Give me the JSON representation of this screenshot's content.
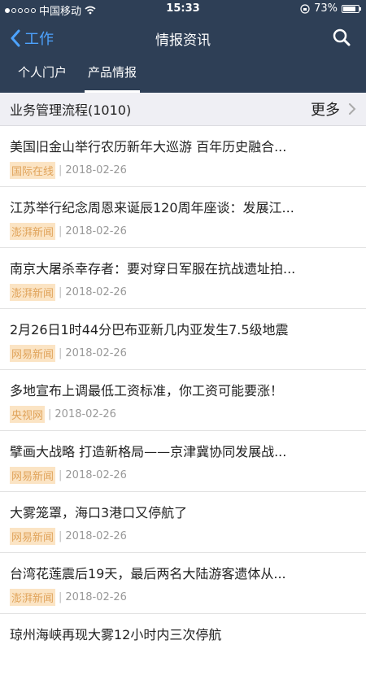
{
  "status_bar": {
    "carrier": "中国移动",
    "time": "15:33",
    "battery": "73%",
    "battery_level": 0.73
  },
  "nav": {
    "back_label": "工作",
    "title": "情报资讯"
  },
  "tabs": [
    {
      "label": "个人门户",
      "active": false
    },
    {
      "label": "产品情报",
      "active": true
    }
  ],
  "section": {
    "title": "业务管理流程(1010)",
    "more_label": "更多"
  },
  "news": [
    {
      "title": "美国旧金山举行农历新年大巡游 百年历史融合...",
      "source": "国际在线",
      "date": "2018-02-26"
    },
    {
      "title": "江苏举行纪念周恩来诞辰120周年座谈：发展江...",
      "source": "澎湃新闻",
      "date": "2018-02-26"
    },
    {
      "title": "南京大屠杀幸存者：要对穿日军服在抗战遗址拍...",
      "source": "澎湃新闻",
      "date": "2018-02-26"
    },
    {
      "title": "2月26日1时44分巴布亚新几内亚发生7.5级地震",
      "source": "网易新闻",
      "date": "2018-02-26"
    },
    {
      "title": "多地宣布上调最低工资标准，你工资可能要涨！",
      "source": "央视网",
      "date": "2018-02-26"
    },
    {
      "title": "擘画大战略 打造新格局——京津冀协同发展战...",
      "source": "网易新闻",
      "date": "2018-02-26"
    },
    {
      "title": "大雾笼罩，海口3港口又停航了",
      "source": "网易新闻",
      "date": "2018-02-26"
    },
    {
      "title": "台湾花莲震后19天，最后两名大陆游客遗体从...",
      "source": "澎湃新闻",
      "date": "2018-02-26"
    },
    {
      "title": "琼州海峡再现大雾12小时内三次停航",
      "source": "",
      "date": ""
    }
  ]
}
